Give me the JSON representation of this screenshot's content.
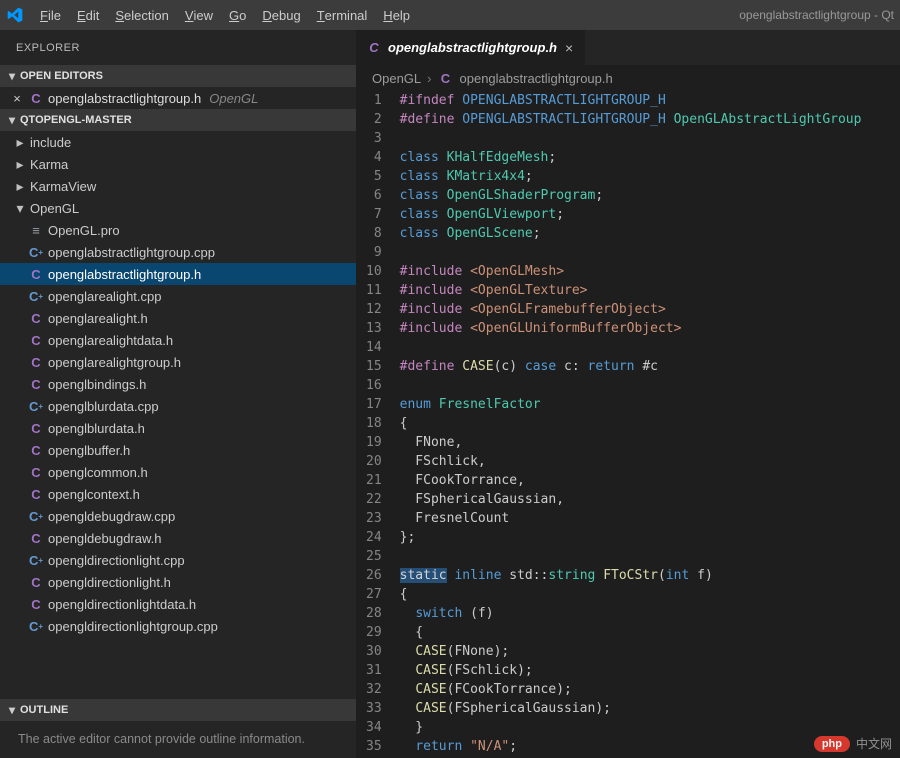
{
  "titlebar": {
    "menus": [
      "File",
      "Edit",
      "Selection",
      "View",
      "Go",
      "Debug",
      "Terminal",
      "Help"
    ],
    "window_title": "openglabstractlightgroup - Qt"
  },
  "explorer": {
    "title": "EXPLORER",
    "open_editors_label": "OPEN EDITORS",
    "open_editor": {
      "name": "openglabstractlightgroup.h",
      "sub": "OpenGL"
    },
    "workspace_label": "QTOPENGL-MASTER",
    "folders": [
      {
        "name": "include",
        "expanded": false
      },
      {
        "name": "Karma",
        "expanded": false
      },
      {
        "name": "KarmaView",
        "expanded": false
      },
      {
        "name": "OpenGL",
        "expanded": true
      }
    ],
    "opengl_files": [
      {
        "name": "OpenGL.pro",
        "kind": "file"
      },
      {
        "name": "openglabstractlightgroup.cpp",
        "kind": "cpp"
      },
      {
        "name": "openglabstractlightgroup.h",
        "kind": "c",
        "active": true
      },
      {
        "name": "openglarealight.cpp",
        "kind": "cpp"
      },
      {
        "name": "openglarealight.h",
        "kind": "c"
      },
      {
        "name": "openglarealightdata.h",
        "kind": "c"
      },
      {
        "name": "openglarealightgroup.h",
        "kind": "c"
      },
      {
        "name": "openglbindings.h",
        "kind": "c"
      },
      {
        "name": "openglblurdata.cpp",
        "kind": "cpp"
      },
      {
        "name": "openglblurdata.h",
        "kind": "c"
      },
      {
        "name": "openglbuffer.h",
        "kind": "c"
      },
      {
        "name": "openglcommon.h",
        "kind": "c"
      },
      {
        "name": "openglcontext.h",
        "kind": "c"
      },
      {
        "name": "opengldebugdraw.cpp",
        "kind": "cpp"
      },
      {
        "name": "opengldebugdraw.h",
        "kind": "c"
      },
      {
        "name": "opengldirectionlight.cpp",
        "kind": "cpp"
      },
      {
        "name": "opengldirectionlight.h",
        "kind": "c"
      },
      {
        "name": "opengldirectionlightdata.h",
        "kind": "c"
      },
      {
        "name": "opengldirectionlightgroup.cpp",
        "kind": "cpp"
      }
    ],
    "outline_label": "OUTLINE",
    "outline_msg": "The active editor cannot provide outline information."
  },
  "editor": {
    "tab": {
      "name": "openglabstractlightgroup.h"
    },
    "breadcrumbs": [
      "OpenGL",
      "openglabstractlightgroup.h"
    ]
  },
  "watermark": {
    "pill": "php",
    "text": "中文网"
  }
}
